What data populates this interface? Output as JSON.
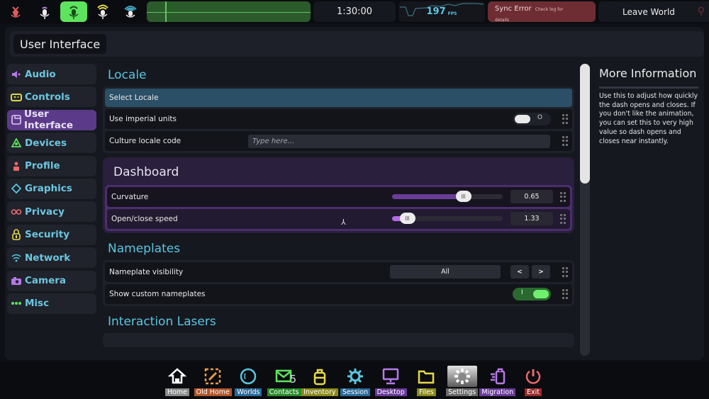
{
  "topbar": {
    "mic_modes": [
      {
        "name": "muted",
        "color": "#e05d5d"
      },
      {
        "name": "whisper",
        "color": "#b98ae6"
      },
      {
        "name": "normal",
        "color": "#1a4a1a",
        "active": true
      },
      {
        "name": "shout",
        "color": "#e6d94a"
      },
      {
        "name": "broadcast",
        "color": "#4ab8d8"
      }
    ],
    "session_time": "1:30:00",
    "fps_value": "197",
    "fps_unit": "FPS",
    "sync_error_title": "Sync Error",
    "sync_error_detail_1": "Check log for",
    "sync_error_detail_2": "details",
    "leave_world_label": "Leave World"
  },
  "window": {
    "title": "User Interface"
  },
  "sidebar": {
    "items": [
      {
        "label": "Audio",
        "icon": "speaker-icon",
        "color": "#b57ae6"
      },
      {
        "label": "Controls",
        "icon": "gamepad-icon",
        "color": "#d9d94a"
      },
      {
        "label": "User Interface",
        "icon": "window-icon",
        "color": "#e0c9f5",
        "selected": true
      },
      {
        "label": "Devices",
        "icon": "devices-icon",
        "color": "#5ee35e"
      },
      {
        "label": "Profile",
        "icon": "person-icon",
        "color": "#e86a6a"
      },
      {
        "label": "Graphics",
        "icon": "diamond-icon",
        "color": "#5ac6e2"
      },
      {
        "label": "Privacy",
        "icon": "infinity-icon",
        "color": "#e86a6a"
      },
      {
        "label": "Security",
        "icon": "lock-icon",
        "color": "#e6d94a"
      },
      {
        "label": "Network",
        "icon": "wifi-icon",
        "color": "#5ac6e2"
      },
      {
        "label": "Camera",
        "icon": "camera-icon",
        "color": "#b57ae6"
      },
      {
        "label": "Misc",
        "icon": "dots-icon",
        "color": "#5ee35e"
      }
    ]
  },
  "locale": {
    "title": "Locale",
    "select_locale": "Select Locale",
    "imperial_label": "Use imperial units",
    "imperial_state": "O",
    "culture_label": "Culture locale code",
    "culture_value": "",
    "culture_placeholder": "Type here..."
  },
  "dashboard": {
    "title": "Dashboard",
    "curvature_label": "Curvature",
    "curvature_value": "0.65",
    "curvature_fraction": 0.65,
    "speed_label": "Open/close speed",
    "speed_value": "1.33",
    "speed_fraction": 0.14
  },
  "nameplates": {
    "title": "Nameplates",
    "visibility_label": "Nameplate visibility",
    "visibility_value": "All",
    "prev_label": "<",
    "next_label": ">",
    "custom_label": "Show custom nameplates",
    "custom_state": "I"
  },
  "lasers": {
    "title": "Interaction Lasers"
  },
  "info": {
    "title": "More Information",
    "body": "Use this to adjust how quickly the dash opens and closes. If you don't like the animation, you can set this to very high value so dash opens and closes near instantly."
  },
  "scroll": {
    "position_fraction": 0.0,
    "visible_fraction": 0.41
  },
  "dock": {
    "items": [
      {
        "label": "Home",
        "icon": "home-icon",
        "color": "#ffffff",
        "bg": "#8a8a8a"
      },
      {
        "label": "Old Home",
        "icon": "old-home-icon",
        "color": "#e89a4a",
        "bg": "#b0552a"
      },
      {
        "label": "Worlds",
        "icon": "worlds-icon",
        "color": "#5ac6e2",
        "bg": "#2a6a9a"
      },
      {
        "label": "Contacts",
        "icon": "contacts-icon",
        "color": "#5ee35e",
        "bg": "#2a8a2a",
        "badge": "5"
      },
      {
        "label": "Inventory",
        "icon": "inventory-icon",
        "color": "#e6d94a",
        "bg": "#8a8a1a"
      },
      {
        "label": "Session",
        "icon": "session-icon",
        "color": "#5ac6e2",
        "bg": "#2a6a9a"
      },
      {
        "label": "Desktop",
        "icon": "desktop-icon",
        "color": "#b57ae6",
        "bg": "#6a3a9a"
      },
      {
        "label": "Files",
        "icon": "files-icon",
        "color": "#e6d94a",
        "bg": "#8a8a1a"
      },
      {
        "label": "Settings",
        "icon": "settings-icon",
        "color": "#ffffff",
        "bg": "#6a6a6a",
        "selected": true
      },
      {
        "label": "Migration",
        "icon": "migration-icon",
        "color": "#b57ae6",
        "bg": "#6a3a9a"
      },
      {
        "label": "Exit",
        "icon": "power-icon",
        "color": "#e86a6a",
        "bg": "#9a2a2a"
      }
    ]
  }
}
